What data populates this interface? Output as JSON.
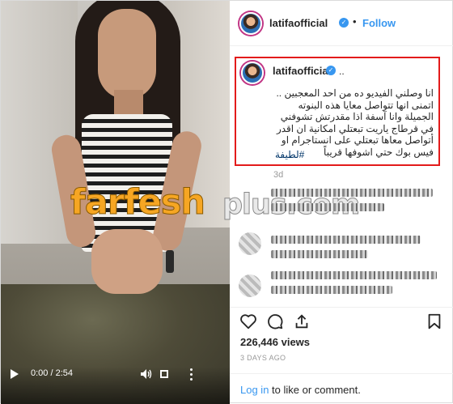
{
  "post": {
    "username": "latifaofficial",
    "dot": "•",
    "follow_label": "Follow",
    "caption_suffix": "..",
    "caption": "انا وصلني الفيديو ده من احد المعجبين .. اتمنى انها تتواصل معايا هذه البنوته الجميلة وانا آسفة اذا مقدرتش تشوفني في قرطاج ياريت تبعتلي امكانية ان اقدر أتواصل معاها تبعتلي على انستاجرام او فيس بوك حتي اشوفها قريباً",
    "hashtag": "#لطيفة",
    "caption_time": "3d",
    "views": "226,446 views",
    "posted_ago": "3 DAYS AGO"
  },
  "video": {
    "time": "0:00 / 2:54"
  },
  "watermark": {
    "main": "farfesh",
    "sub": "plus.com"
  },
  "comment_bar": {
    "login_link": "Log in",
    "rest": " to like or comment."
  },
  "colors": {
    "accent": "#3897f0",
    "highlight_border": "#e31b1b"
  }
}
